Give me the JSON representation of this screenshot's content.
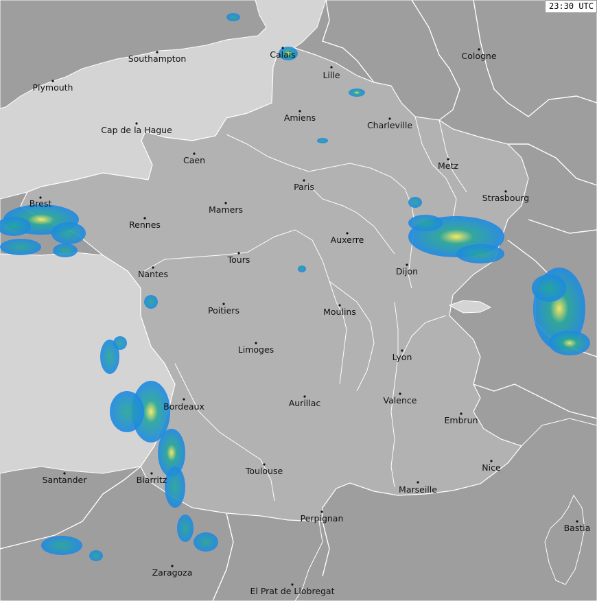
{
  "timestamp": "23:30 UTC",
  "colors": {
    "sea": "#d4d4d4",
    "land": "#9e9e9e",
    "france": "#b2b2b2",
    "border": "#ffffff",
    "river": "#ffffff",
    "radar_light": "#1e88e5",
    "radar_mid": "#26a69a",
    "radar_heavy": "#ffee58"
  },
  "cities": [
    {
      "id": "calais",
      "name": "Calais"
    },
    {
      "id": "southampton",
      "name": "Southampton"
    },
    {
      "id": "cologne",
      "name": "Cologne"
    },
    {
      "id": "lille",
      "name": "Lille"
    },
    {
      "id": "plymouth",
      "name": "Plymouth"
    },
    {
      "id": "amiens",
      "name": "Amiens"
    },
    {
      "id": "charleville",
      "name": "Charleville"
    },
    {
      "id": "cap-de-la-hague",
      "name": "Cap de la Hague"
    },
    {
      "id": "caen",
      "name": "Caen"
    },
    {
      "id": "metz",
      "name": "Metz"
    },
    {
      "id": "paris",
      "name": "Paris"
    },
    {
      "id": "strasbourg",
      "name": "Strasbourg"
    },
    {
      "id": "brest",
      "name": "Brest"
    },
    {
      "id": "mamers",
      "name": "Mamers"
    },
    {
      "id": "rennes",
      "name": "Rennes"
    },
    {
      "id": "auxerre",
      "name": "Auxerre"
    },
    {
      "id": "tours",
      "name": "Tours"
    },
    {
      "id": "dijon",
      "name": "Dijon"
    },
    {
      "id": "nantes",
      "name": "Nantes"
    },
    {
      "id": "poitiers",
      "name": "Poitiers"
    },
    {
      "id": "moulins",
      "name": "Moulins"
    },
    {
      "id": "limoges",
      "name": "Limoges"
    },
    {
      "id": "lyon",
      "name": "Lyon"
    },
    {
      "id": "valence",
      "name": "Valence"
    },
    {
      "id": "bordeaux",
      "name": "Bordeaux"
    },
    {
      "id": "aurillac",
      "name": "Aurillac"
    },
    {
      "id": "embrun",
      "name": "Embrun"
    },
    {
      "id": "nice",
      "name": "Nice"
    },
    {
      "id": "toulouse",
      "name": "Toulouse"
    },
    {
      "id": "santander",
      "name": "Santander"
    },
    {
      "id": "biarritz",
      "name": "Biarritz"
    },
    {
      "id": "marseille",
      "name": "Marseille"
    },
    {
      "id": "perpignan",
      "name": "Perpignan"
    },
    {
      "id": "bastia",
      "name": "Bastia"
    },
    {
      "id": "zaragoza",
      "name": "Zaragoza"
    },
    {
      "id": "el-prat",
      "name": "El Prat de Llobregat"
    }
  ]
}
